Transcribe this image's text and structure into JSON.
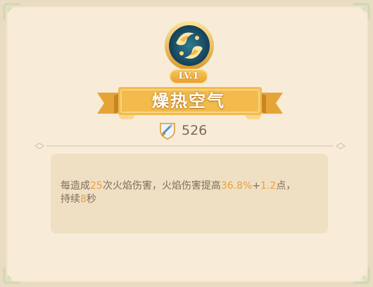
{
  "skill": {
    "level_label": "LV.1",
    "name": "燥热空气",
    "cost": "526",
    "description": {
      "p1": "每造成",
      "v1": "25",
      "p2": "次火焰伤害，火焰伤害提高",
      "v2": "36.8%",
      "p3": "+",
      "v3": "1.2",
      "p4": "点，",
      "p5": "持续",
      "v4": "8",
      "p6": "秒"
    }
  },
  "colors": {
    "accent": "#e8a040",
    "panel_bg": "#f8ecd9",
    "desc_bg": "#f0e0c3",
    "text": "#7d6d5a",
    "ribbon": "#f0b848"
  },
  "icons": {
    "emblem": "fire-swirl-emblem-icon",
    "cost": "shield-sword-icon"
  }
}
